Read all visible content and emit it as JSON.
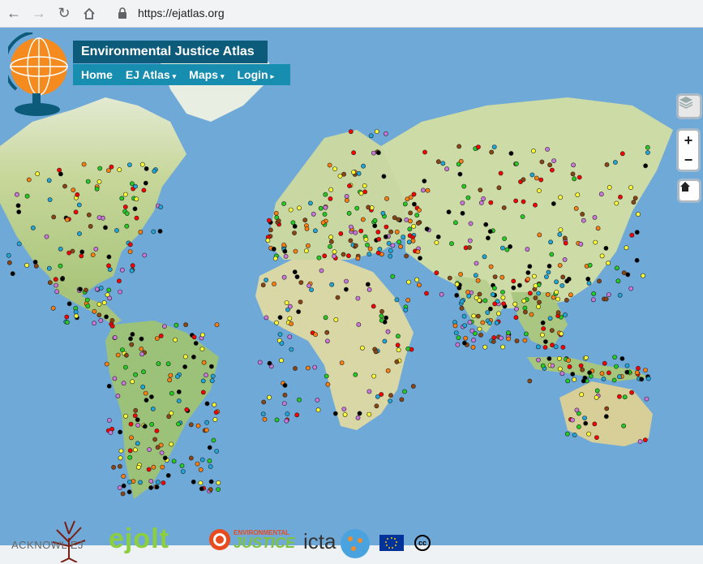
{
  "browser": {
    "url": "https://ejatlas.org",
    "icons": [
      "back-arrow-icon",
      "forward-arrow-icon",
      "reload-icon",
      "home-icon",
      "lock-icon"
    ]
  },
  "site": {
    "title": "Environmental Justice Atlas",
    "nav": [
      {
        "label": "Home",
        "caret": ""
      },
      {
        "label": "EJ Atlas",
        "caret": "▾"
      },
      {
        "label": "Maps",
        "caret": "▾"
      },
      {
        "label": "Login",
        "caret": "▸"
      }
    ]
  },
  "map_controls": {
    "zoom_in": "+",
    "zoom_out": "−",
    "icons": [
      "layers-icon",
      "home-icon"
    ]
  },
  "footer": {
    "acknowl": "ACKNOWL EJ",
    "ejolt": "ejolt",
    "env_just_line1": "ENVIRONMENTAL",
    "env_just_line2": "JUSTICE",
    "icta": "icta",
    "cc": "cc"
  },
  "colors": {
    "ocean": "#6fa9d8",
    "land": "#c9d6a0",
    "title_bg": "#0d5b7a",
    "nav_bg": "#178eb0",
    "markers": [
      "#ff7f0e",
      "#000000",
      "#1ea7d8",
      "#ffff33",
      "#ff0000",
      "#22cc22",
      "#8b4513",
      "#cc77dd"
    ]
  }
}
